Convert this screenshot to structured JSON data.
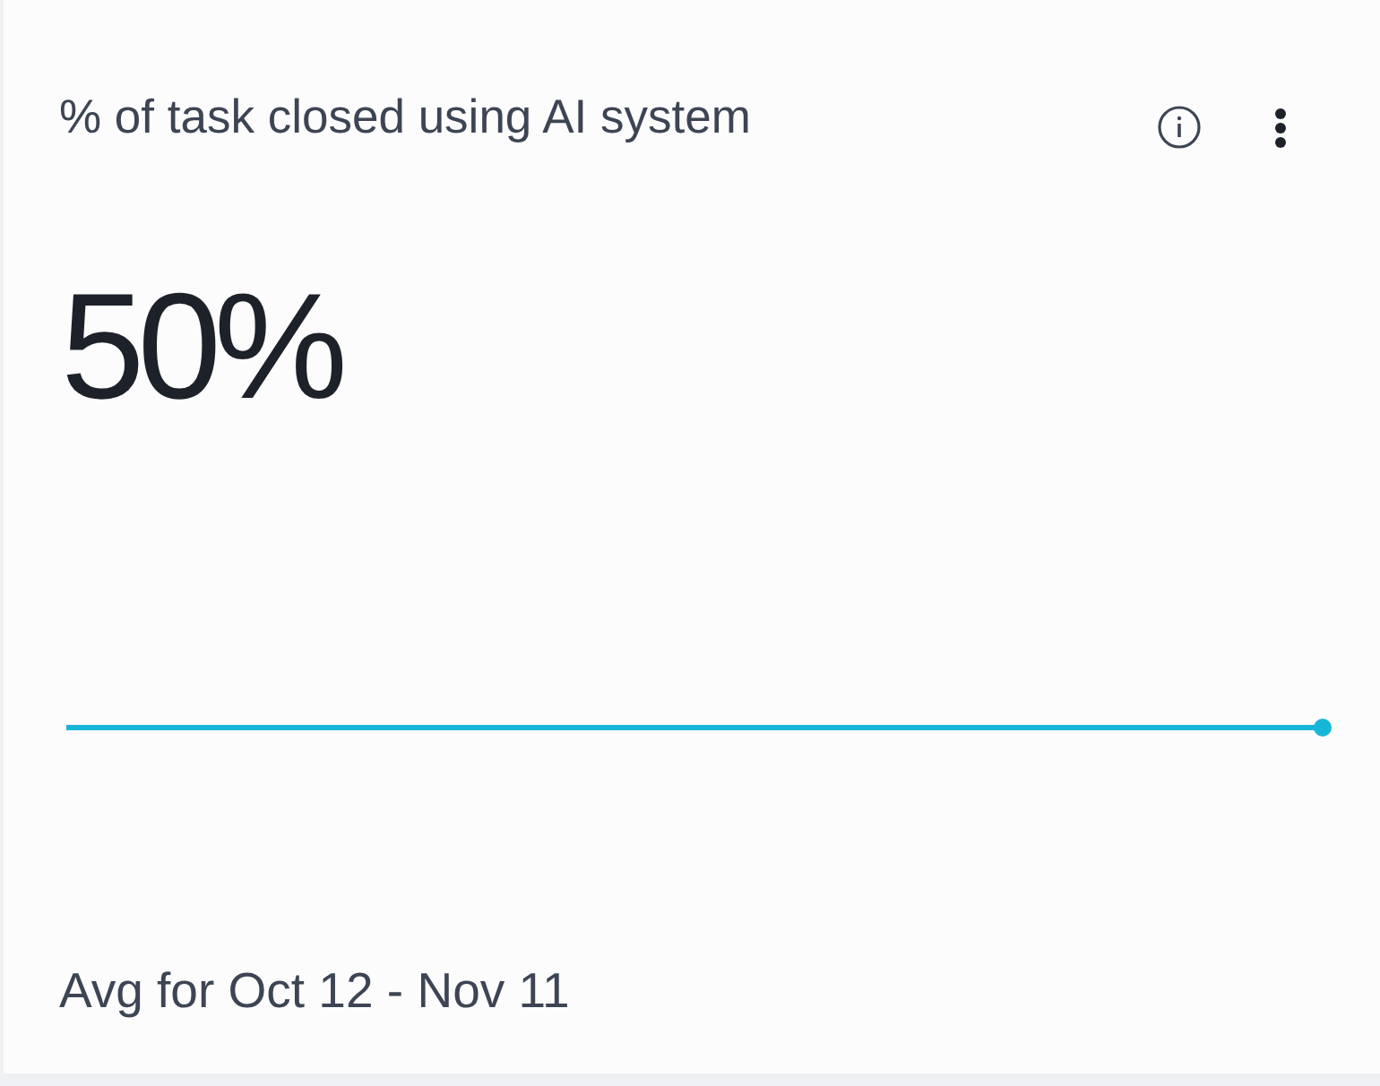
{
  "card": {
    "title": "% of task closed using AI system",
    "value": "50%",
    "footer": "Avg for Oct 12 - Nov 11"
  }
}
